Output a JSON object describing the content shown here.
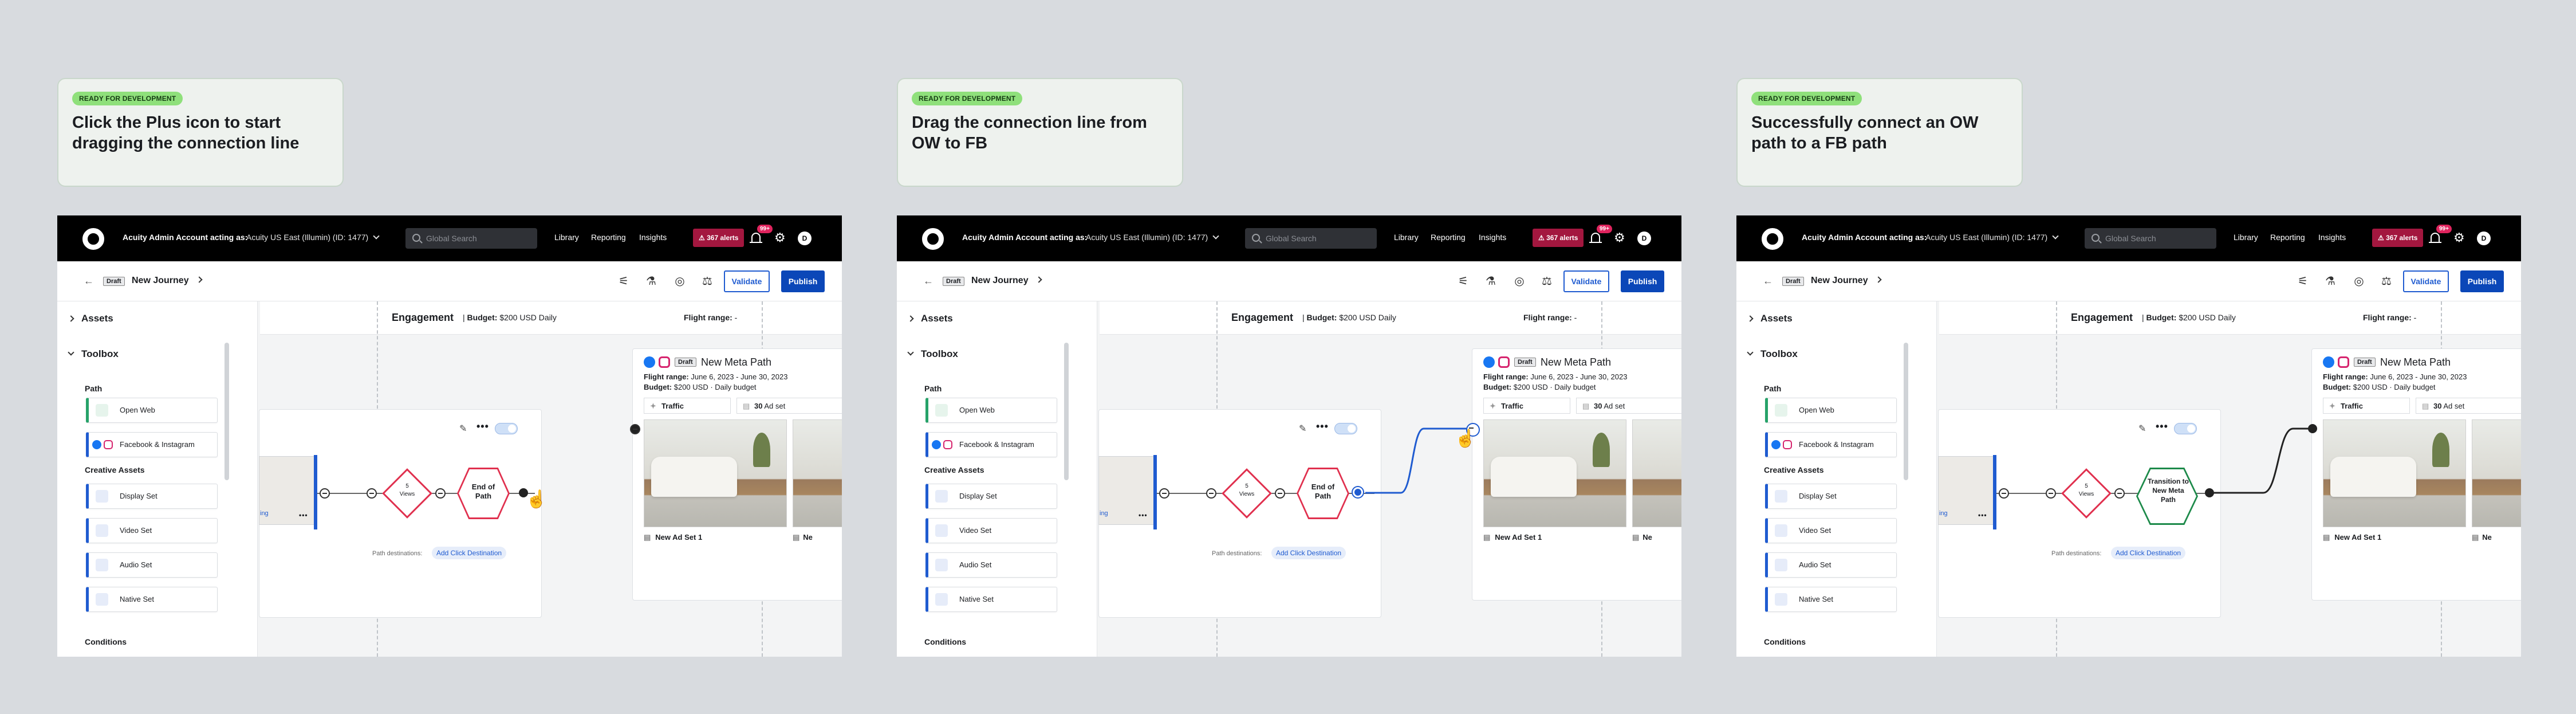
{
  "steps": [
    {
      "badge": "READY FOR DEVELOPMENT",
      "title": "Click the Plus icon to start dragging the connection line",
      "end_node_label": "End of Path"
    },
    {
      "badge": "READY FOR DEVELOPMENT",
      "title": "Drag the connection line from OW to FB",
      "end_node_label": "End of Path"
    },
    {
      "badge": "READY FOR DEVELOPMENT",
      "title": "Successfully connect an OW path to a FB path",
      "end_node_label": "Transition to New Meta Path"
    }
  ],
  "topbar": {
    "account_label": "Acuity Admin Account acting as:",
    "account_value": "Acuity US East (Illumin) (ID: 1477)",
    "search_placeholder": "Global Search",
    "nav": [
      "Library",
      "Reporting",
      "Insights"
    ],
    "alerts": "⚠ 367 alerts",
    "notif_count": "99+",
    "avatar": "D"
  },
  "journey": {
    "draft": "Draft",
    "title": "New Journey",
    "validate": "Validate",
    "publish": "Publish"
  },
  "engagement": {
    "title": "Engagement",
    "budget_label": "Budget:",
    "budget_value": "$200 USD Daily",
    "flight_label": "Flight range:"
  },
  "sidebar": {
    "assets": "Assets",
    "toolbox": "Toolbox",
    "path_label": "Path",
    "path_items": [
      "Open Web",
      "Facebook & Instagram"
    ],
    "creative_label": "Creative Assets",
    "creative_items": [
      "Display Set",
      "Video Set",
      "Audio Set",
      "Native Set"
    ],
    "conditions_label": "Conditions"
  },
  "path_card": {
    "diamond_count": "5",
    "diamond_label": "Views",
    "path_destinations": "Path destinations:",
    "add_click": "Add Click Destination",
    "stub_text": "ing"
  },
  "meta_card": {
    "draft": "Draft",
    "title": "New Meta Path",
    "flight_label": "Flight range:",
    "flight_value": "June 6, 2023 - June 30, 2023",
    "budget_label": "Budget:",
    "budget_value": "$200 USD · Daily budget",
    "tag_traffic": "Traffic",
    "tag_adset_num": "30",
    "tag_adset": "Ad set",
    "adset_name": "New Ad Set 1",
    "adset_name_cut": "Ne"
  },
  "colors": {
    "accent": "#0b47b8",
    "danger": "#e0304e",
    "success": "#1d8a4a",
    "badge": "#8fe07b"
  }
}
